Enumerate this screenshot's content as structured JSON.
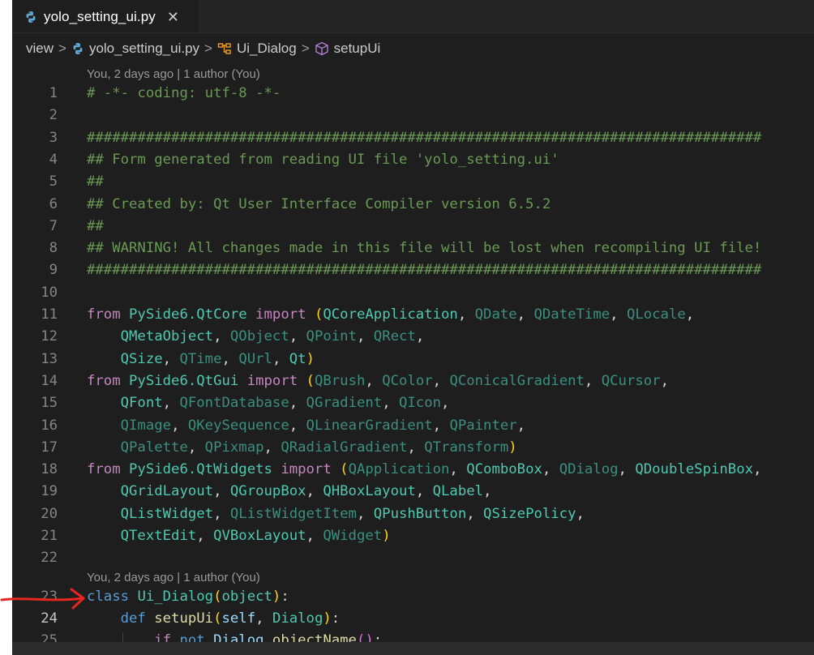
{
  "tab": {
    "filename": "yolo_setting_ui.py",
    "close_glyph": "✕"
  },
  "breadcrumb": {
    "items": [
      "view",
      "yolo_setting_ui.py",
      "Ui_Dialog",
      "setupUi"
    ],
    "separator": ">"
  },
  "codelens": [
    {
      "text": "You, 2 days ago | 1 author (You)",
      "before_line": 1
    },
    {
      "text": "You, 2 days ago | 1 author (You)",
      "before_line": 23
    }
  ],
  "lines": [
    {
      "n": "1",
      "tokens": [
        [
          "c-comment",
          "# -*- coding: utf-8 -*-"
        ]
      ]
    },
    {
      "n": "2",
      "tokens": []
    },
    {
      "n": "3",
      "tokens": [
        [
          "c-comment",
          "################################################################################"
        ]
      ]
    },
    {
      "n": "4",
      "tokens": [
        [
          "c-comment",
          "## Form generated from reading UI file 'yolo_setting.ui'"
        ]
      ]
    },
    {
      "n": "5",
      "tokens": [
        [
          "c-comment",
          "##"
        ]
      ]
    },
    {
      "n": "6",
      "tokens": [
        [
          "c-comment",
          "## Created by: Qt User Interface Compiler version 6.5.2"
        ]
      ]
    },
    {
      "n": "7",
      "tokens": [
        [
          "c-comment",
          "##"
        ]
      ]
    },
    {
      "n": "8",
      "tokens": [
        [
          "c-comment",
          "## WARNING! All changes made in this file will be lost when recompiling UI file!"
        ]
      ]
    },
    {
      "n": "9",
      "tokens": [
        [
          "c-comment",
          "################################################################################"
        ]
      ]
    },
    {
      "n": "10",
      "tokens": []
    },
    {
      "n": "11",
      "tokens": [
        [
          "c-key",
          "from"
        ],
        [
          "c-plain",
          " "
        ],
        [
          "c-mod",
          "PySide6.QtCore"
        ],
        [
          "c-plain",
          " "
        ],
        [
          "c-key",
          "import"
        ],
        [
          "c-plain",
          " "
        ],
        [
          "c-paren1",
          "("
        ],
        [
          "c-cls",
          "QCoreApplication"
        ],
        [
          "c-plain",
          ", "
        ],
        [
          "c-dim",
          "QDate"
        ],
        [
          "c-plain",
          ", "
        ],
        [
          "c-dim",
          "QDateTime"
        ],
        [
          "c-plain",
          ", "
        ],
        [
          "c-dim",
          "QLocale"
        ],
        [
          "c-plain",
          ","
        ]
      ]
    },
    {
      "n": "12",
      "tokens": [
        [
          "c-plain",
          "    "
        ],
        [
          "c-cls",
          "QMetaObject"
        ],
        [
          "c-plain",
          ", "
        ],
        [
          "c-dim",
          "QObject"
        ],
        [
          "c-plain",
          ", "
        ],
        [
          "c-dim",
          "QPoint"
        ],
        [
          "c-plain",
          ", "
        ],
        [
          "c-dim",
          "QRect"
        ],
        [
          "c-plain",
          ","
        ]
      ]
    },
    {
      "n": "13",
      "tokens": [
        [
          "c-plain",
          "    "
        ],
        [
          "c-cls",
          "QSize"
        ],
        [
          "c-plain",
          ", "
        ],
        [
          "c-dim",
          "QTime"
        ],
        [
          "c-plain",
          ", "
        ],
        [
          "c-dim",
          "QUrl"
        ],
        [
          "c-plain",
          ", "
        ],
        [
          "c-cls",
          "Qt"
        ],
        [
          "c-paren1",
          ")"
        ]
      ]
    },
    {
      "n": "14",
      "tokens": [
        [
          "c-key",
          "from"
        ],
        [
          "c-plain",
          " "
        ],
        [
          "c-mod",
          "PySide6.QtGui"
        ],
        [
          "c-plain",
          " "
        ],
        [
          "c-key",
          "import"
        ],
        [
          "c-plain",
          " "
        ],
        [
          "c-paren1",
          "("
        ],
        [
          "c-dim",
          "QBrush"
        ],
        [
          "c-plain",
          ", "
        ],
        [
          "c-dim",
          "QColor"
        ],
        [
          "c-plain",
          ", "
        ],
        [
          "c-dim",
          "QConicalGradient"
        ],
        [
          "c-plain",
          ", "
        ],
        [
          "c-dim",
          "QCursor"
        ],
        [
          "c-plain",
          ","
        ]
      ]
    },
    {
      "n": "15",
      "tokens": [
        [
          "c-plain",
          "    "
        ],
        [
          "c-cls",
          "QFont"
        ],
        [
          "c-plain",
          ", "
        ],
        [
          "c-dim",
          "QFontDatabase"
        ],
        [
          "c-plain",
          ", "
        ],
        [
          "c-dim",
          "QGradient"
        ],
        [
          "c-plain",
          ", "
        ],
        [
          "c-dim",
          "QIcon"
        ],
        [
          "c-plain",
          ","
        ]
      ]
    },
    {
      "n": "16",
      "tokens": [
        [
          "c-plain",
          "    "
        ],
        [
          "c-dim",
          "QImage"
        ],
        [
          "c-plain",
          ", "
        ],
        [
          "c-dim",
          "QKeySequence"
        ],
        [
          "c-plain",
          ", "
        ],
        [
          "c-dim",
          "QLinearGradient"
        ],
        [
          "c-plain",
          ", "
        ],
        [
          "c-dim",
          "QPainter"
        ],
        [
          "c-plain",
          ","
        ]
      ]
    },
    {
      "n": "17",
      "tokens": [
        [
          "c-plain",
          "    "
        ],
        [
          "c-dim",
          "QPalette"
        ],
        [
          "c-plain",
          ", "
        ],
        [
          "c-dim",
          "QPixmap"
        ],
        [
          "c-plain",
          ", "
        ],
        [
          "c-dim",
          "QRadialGradient"
        ],
        [
          "c-plain",
          ", "
        ],
        [
          "c-dim",
          "QTransform"
        ],
        [
          "c-paren1",
          ")"
        ]
      ]
    },
    {
      "n": "18",
      "tokens": [
        [
          "c-key",
          "from"
        ],
        [
          "c-plain",
          " "
        ],
        [
          "c-mod",
          "PySide6.QtWidgets"
        ],
        [
          "c-plain",
          " "
        ],
        [
          "c-key",
          "import"
        ],
        [
          "c-plain",
          " "
        ],
        [
          "c-paren1",
          "("
        ],
        [
          "c-dim",
          "QApplication"
        ],
        [
          "c-plain",
          ", "
        ],
        [
          "c-cls",
          "QComboBox"
        ],
        [
          "c-plain",
          ", "
        ],
        [
          "c-dim",
          "QDialog"
        ],
        [
          "c-plain",
          ", "
        ],
        [
          "c-cls",
          "QDoubleSpinBox"
        ],
        [
          "c-plain",
          ","
        ]
      ]
    },
    {
      "n": "19",
      "tokens": [
        [
          "c-plain",
          "    "
        ],
        [
          "c-cls",
          "QGridLayout"
        ],
        [
          "c-plain",
          ", "
        ],
        [
          "c-cls",
          "QGroupBox"
        ],
        [
          "c-plain",
          ", "
        ],
        [
          "c-cls",
          "QHBoxLayout"
        ],
        [
          "c-plain",
          ", "
        ],
        [
          "c-cls",
          "QLabel"
        ],
        [
          "c-plain",
          ","
        ]
      ]
    },
    {
      "n": "20",
      "tokens": [
        [
          "c-plain",
          "    "
        ],
        [
          "c-cls",
          "QListWidget"
        ],
        [
          "c-plain",
          ", "
        ],
        [
          "c-dim",
          "QListWidgetItem"
        ],
        [
          "c-plain",
          ", "
        ],
        [
          "c-cls",
          "QPushButton"
        ],
        [
          "c-plain",
          ", "
        ],
        [
          "c-cls",
          "QSizePolicy"
        ],
        [
          "c-plain",
          ","
        ]
      ]
    },
    {
      "n": "21",
      "tokens": [
        [
          "c-plain",
          "    "
        ],
        [
          "c-cls",
          "QTextEdit"
        ],
        [
          "c-plain",
          ", "
        ],
        [
          "c-cls",
          "QVBoxLayout"
        ],
        [
          "c-plain",
          ", "
        ],
        [
          "c-dim",
          "QWidget"
        ],
        [
          "c-paren1",
          ")"
        ]
      ]
    },
    {
      "n": "22",
      "tokens": []
    },
    {
      "n": "23",
      "tokens": [
        [
          "c-kw",
          "class"
        ],
        [
          "c-plain",
          " "
        ],
        [
          "c-cls",
          "Ui_Dialog"
        ],
        [
          "c-paren1",
          "("
        ],
        [
          "c-cls",
          "object"
        ],
        [
          "c-paren1",
          ")"
        ],
        [
          "c-plain",
          ":"
        ]
      ]
    },
    {
      "n": "24",
      "tokens": [
        [
          "c-plain",
          "    "
        ],
        [
          "c-kw",
          "def"
        ],
        [
          "c-plain",
          " "
        ],
        [
          "c-fn",
          "setupUi"
        ],
        [
          "c-paren1",
          "("
        ],
        [
          "c-param",
          "self"
        ],
        [
          "c-plain",
          ", "
        ],
        [
          "c-cls",
          "Dialog"
        ],
        [
          "c-paren1",
          ")"
        ],
        [
          "c-plain",
          ":"
        ]
      ]
    },
    {
      "n": "25",
      "tokens": [
        [
          "c-plain",
          "        "
        ],
        [
          "c-key",
          "if"
        ],
        [
          "c-plain",
          " "
        ],
        [
          "c-kw",
          "not"
        ],
        [
          "c-plain",
          " "
        ],
        [
          "c-param",
          "Dialog"
        ],
        [
          "c-plain",
          "."
        ],
        [
          "c-fn",
          "objectName"
        ],
        [
          "c-paren2",
          "()"
        ],
        [
          "c-plain",
          ":"
        ]
      ]
    }
  ],
  "colors": {
    "editor_bg": "#1e1e1e",
    "annotation_arrow": "#e8261f"
  }
}
